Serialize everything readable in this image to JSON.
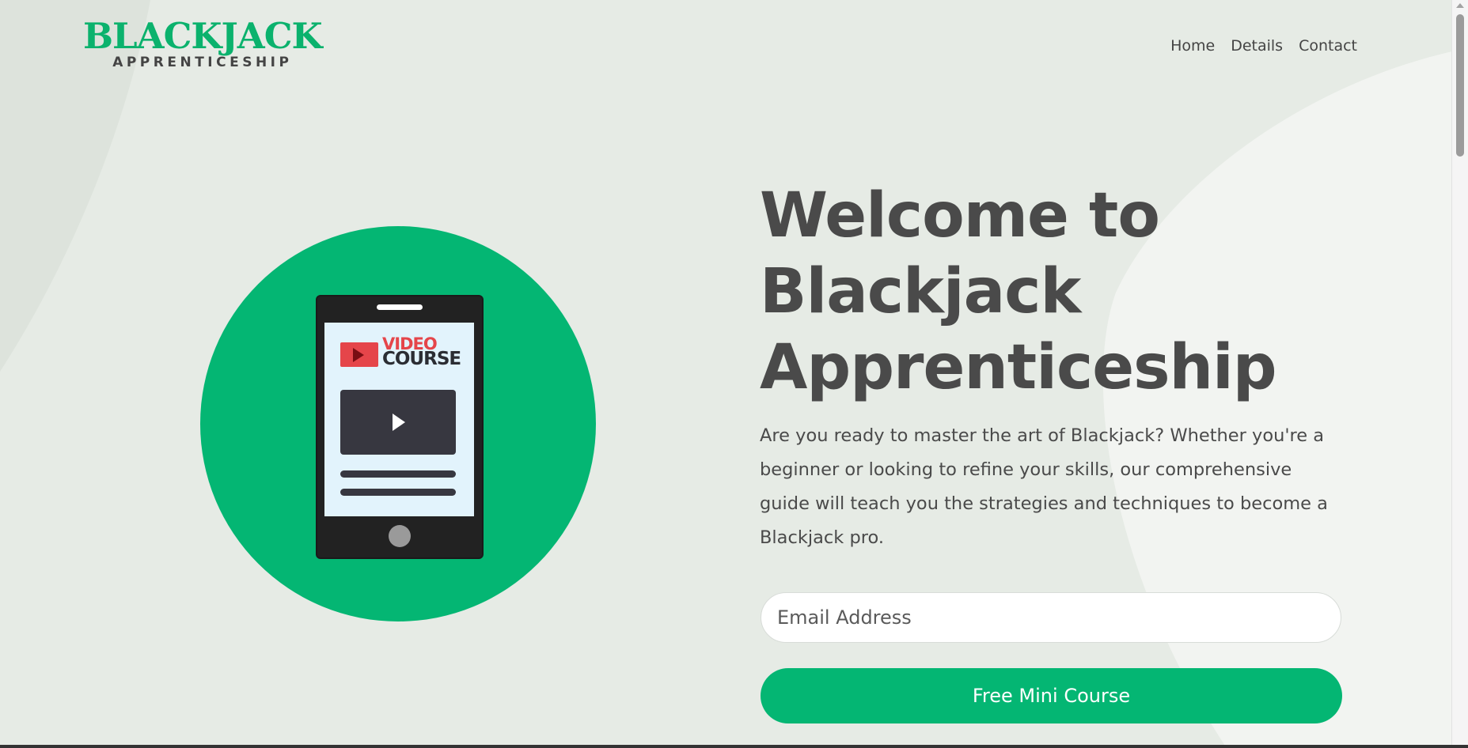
{
  "brand": {
    "name": "BLACKJACK",
    "tagline": "APPRENTICESHIP"
  },
  "nav": {
    "items": [
      "Home",
      "Details",
      "Contact"
    ]
  },
  "hero": {
    "illustration": {
      "badge_line1": "VIDEO",
      "badge_line2": "COURSE"
    },
    "headline": "Welcome to Blackjack Apprenticeship",
    "description": "Are you ready to master the art of Blackjack? Whether you're a beginner or looking to refine your skills, our comprehensive guide will teach you the strategies and techniques to become a Blackjack pro."
  },
  "signup": {
    "email_placeholder": "Email Address",
    "button_label": "Free Mini Course"
  },
  "colors": {
    "accent": "#04b673",
    "logo": "#0bb26d",
    "text": "#4a4a4a",
    "background": "#e6ebe5"
  }
}
